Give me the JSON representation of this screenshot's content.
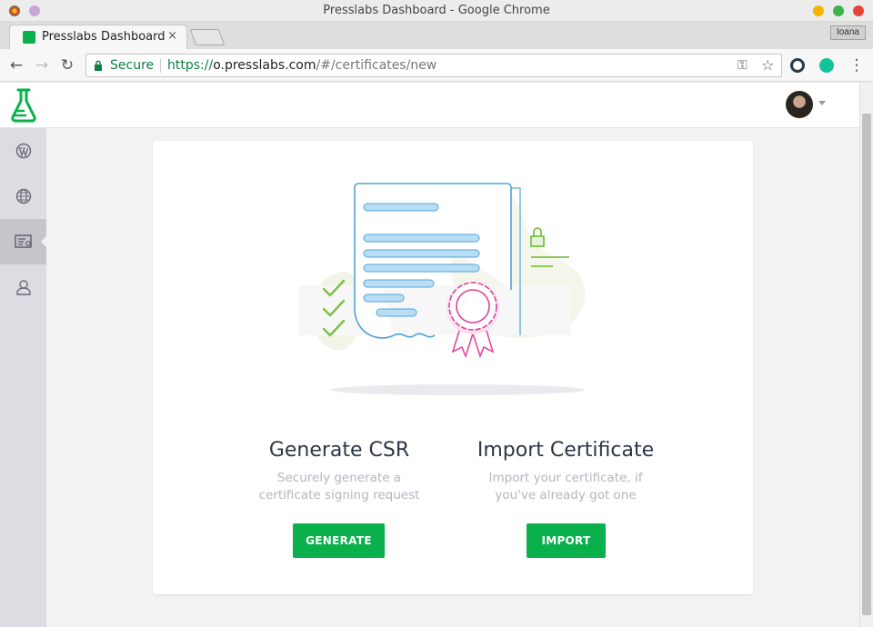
{
  "window": {
    "title": "Presslabs Dashboard - Google Chrome"
  },
  "tabs": [
    {
      "label": "Presslabs Dashboard",
      "close": "×"
    }
  ],
  "profile": {
    "name": "Ioana"
  },
  "address_bar": {
    "secure_label": "Secure",
    "url_scheme": "https://",
    "url_host": "o.presslabs.com",
    "url_path": "/#/certificates/new"
  },
  "nav": {
    "back": "←",
    "forward": "→",
    "reload": "↻",
    "key": "⚿",
    "star": "☆",
    "menu": "⋮"
  },
  "sidebar": {
    "items": [
      {
        "name": "wordpress-icon"
      },
      {
        "name": "globe-icon"
      },
      {
        "name": "certificate-icon",
        "active": true
      },
      {
        "name": "user-icon"
      }
    ]
  },
  "colors": {
    "accent": "#0ab04b",
    "sidebar": "#dcdde2",
    "sidebar_active": "#c4c6cc"
  },
  "options": {
    "generate": {
      "title": "Generate CSR",
      "description": "Securely generate a certificate signing request",
      "button": "GENERATE"
    },
    "import": {
      "title": "Import Certificate",
      "description": "Import your certificate, if you've already got one",
      "button": "IMPORT"
    }
  }
}
